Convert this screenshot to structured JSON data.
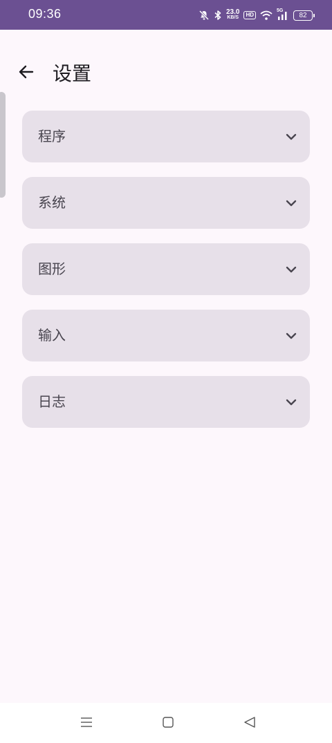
{
  "status_bar": {
    "time": "09:36",
    "net_speed_value": "23.0",
    "net_speed_unit": "KB/S",
    "hd_label": "HD",
    "signal_label": "5G",
    "battery_level": "82",
    "bg_color": "#6b5092"
  },
  "header": {
    "title": "设置",
    "back_icon": "arrow-left-icon"
  },
  "sections": [
    {
      "label": "程序",
      "icon": "chevron-down-icon"
    },
    {
      "label": "系统",
      "icon": "chevron-down-icon"
    },
    {
      "label": "图形",
      "icon": "chevron-down-icon"
    },
    {
      "label": "输入",
      "icon": "chevron-down-icon"
    },
    {
      "label": "日志",
      "icon": "chevron-down-icon"
    }
  ],
  "nav_bar": {
    "buttons": [
      "menu-icon",
      "home-icon",
      "back-icon"
    ]
  },
  "colors": {
    "background": "#fdf7fc",
    "card": "#e7e0e9",
    "text": "#49454f"
  }
}
